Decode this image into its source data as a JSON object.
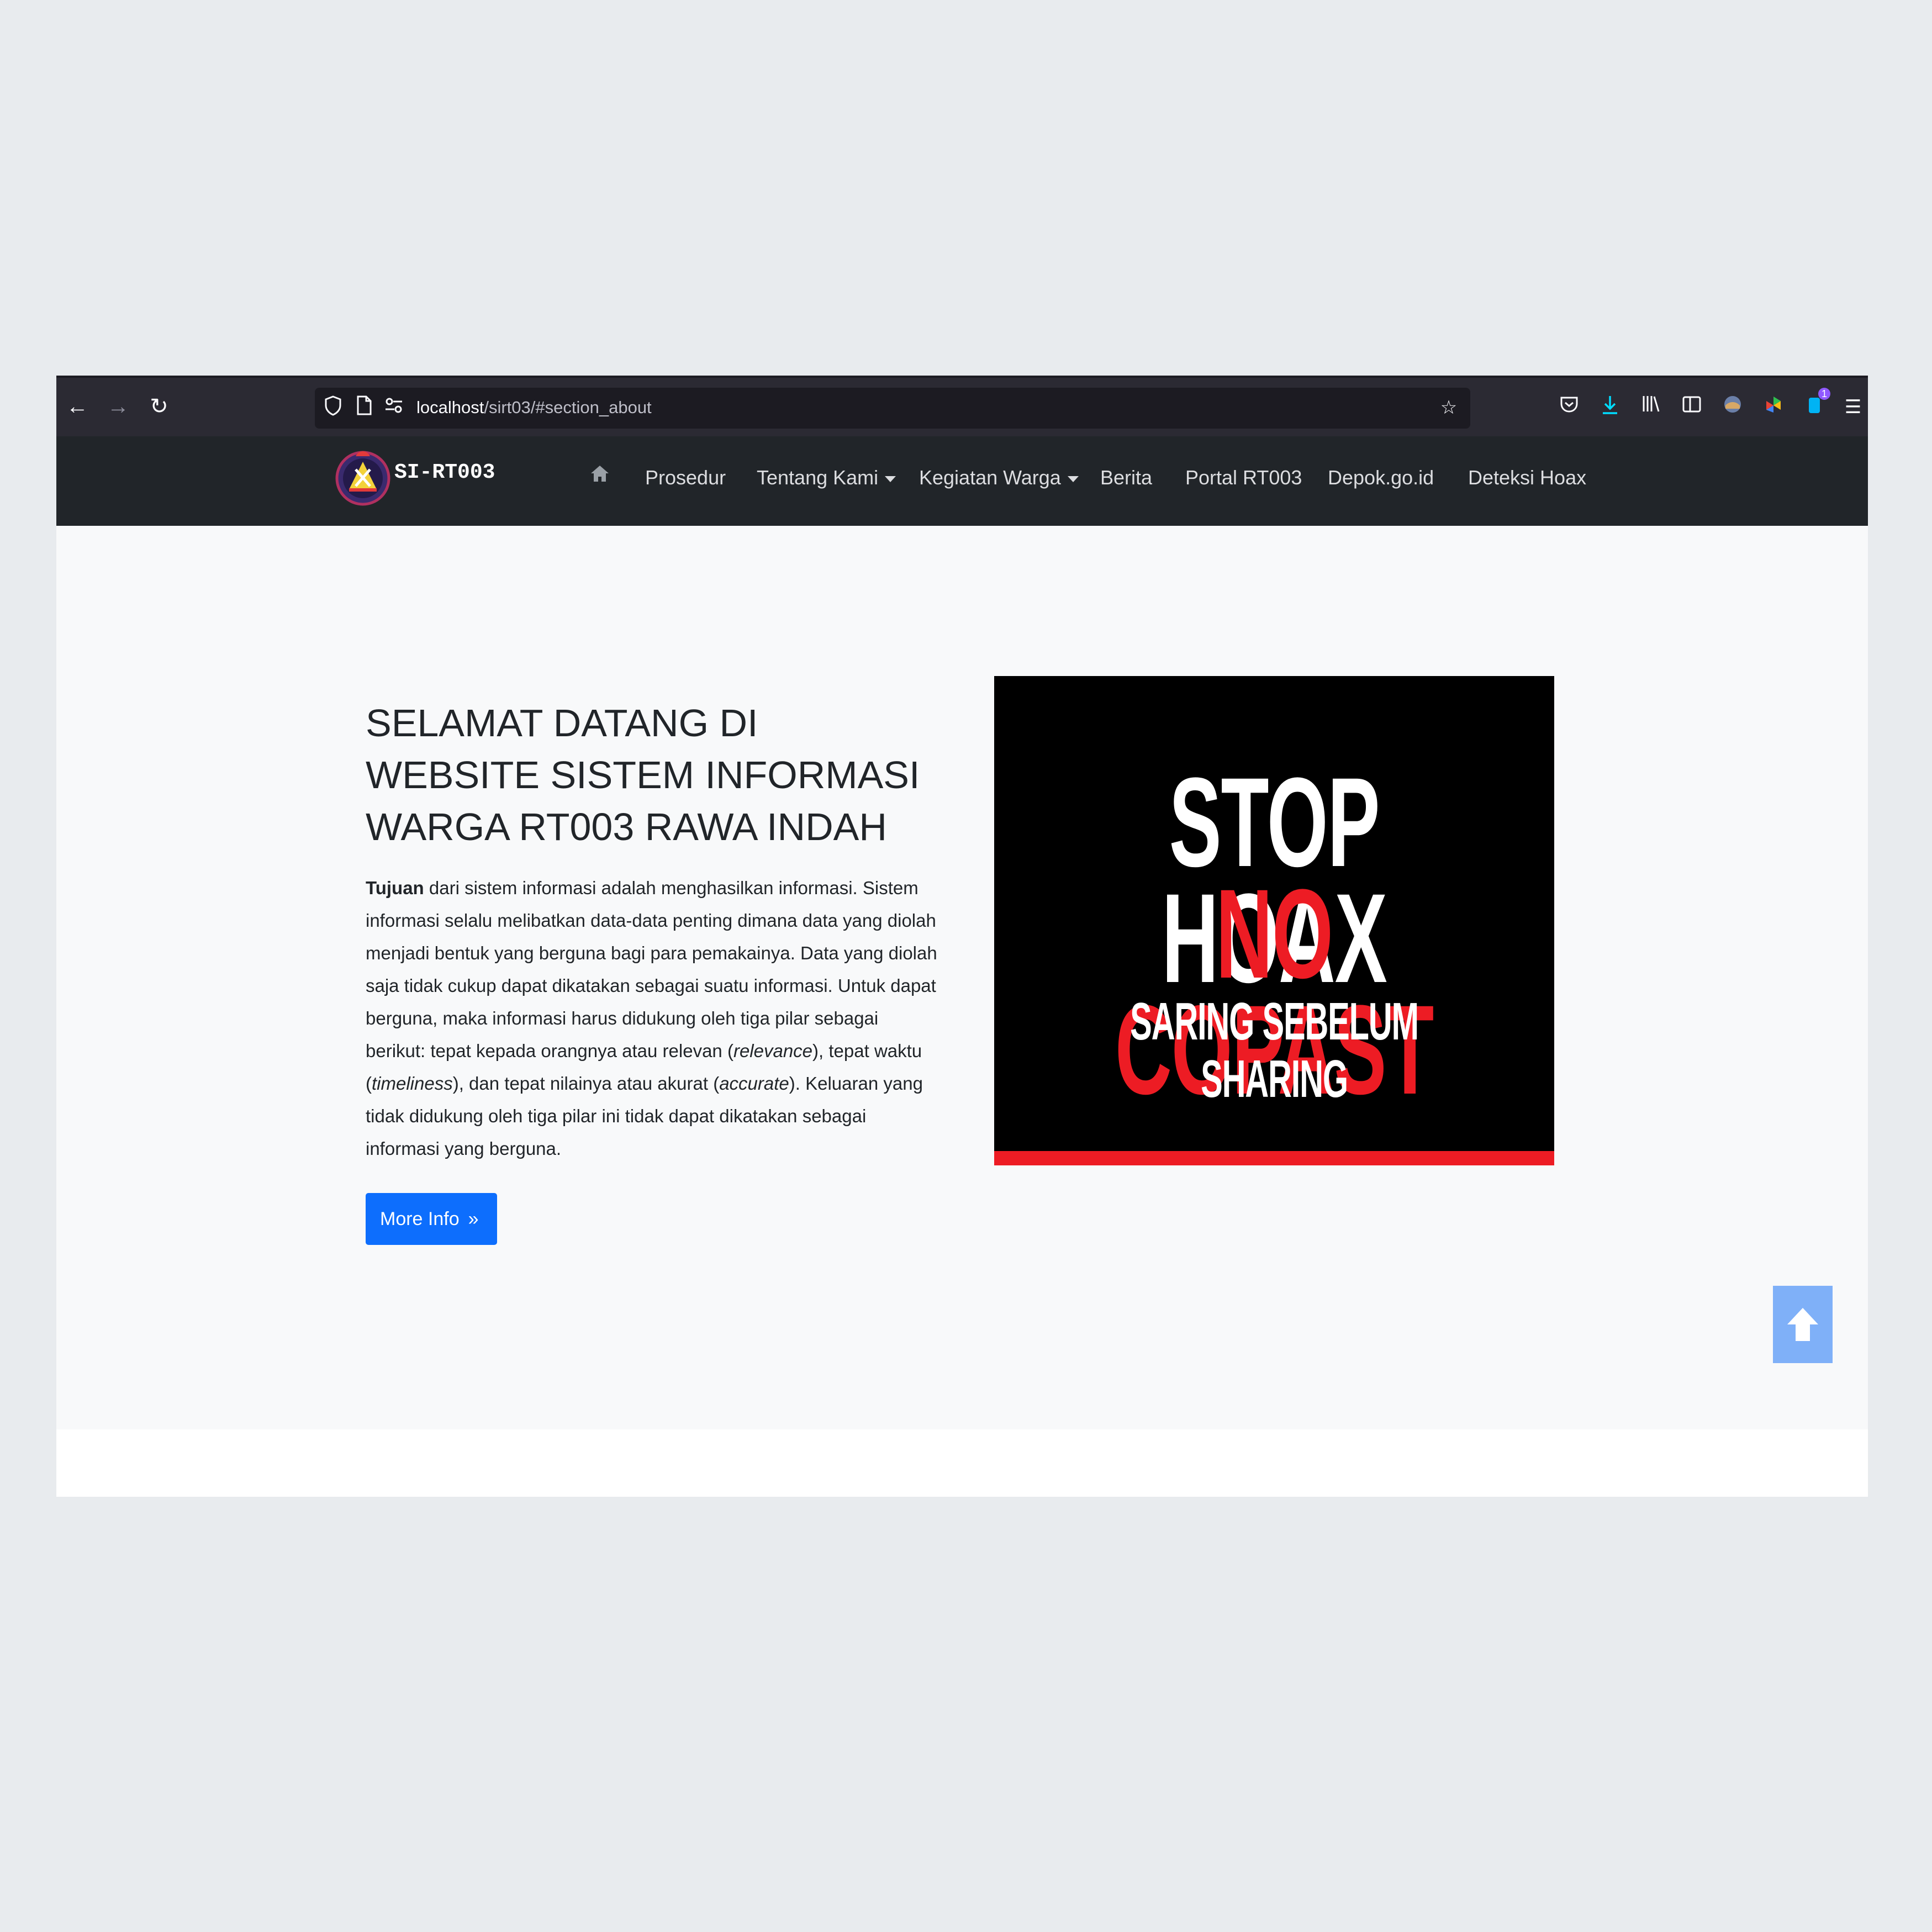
{
  "browser": {
    "url_host": "localhost",
    "url_path": "/sirt03/#section_about",
    "downloads_badge": "1"
  },
  "navbar": {
    "brand": "SI-RT003",
    "items": [
      {
        "label": "Prosedur"
      },
      {
        "label": "Tentang Kami"
      },
      {
        "label": "Kegiatan Warga"
      },
      {
        "label": "Berita"
      },
      {
        "label": "Portal RT003"
      },
      {
        "label": "Depok.go.id"
      },
      {
        "label": "Deteksi Hoax"
      }
    ]
  },
  "about": {
    "heading": "SELAMAT DATANG DI WEBSITE SISTEM INFORMASI WARGA RT003 RAWA INDAH",
    "para": {
      "bold": "Tujuan",
      "t1": " dari sistem informasi adalah menghasilkan informasi. Sistem informasi selalu melibatkan data-data penting dimana data yang diolah menjadi bentuk yang berguna bagi para pemakainya. Data yang diolah saja tidak cukup dapat dikatakan sebagai suatu informasi. Untuk dapat berguna, maka informasi harus didukung oleh tiga pilar sebagai berikut: tepat kepada orangnya atau relevan (",
      "i1": "relevance",
      "t2": "), tepat waktu (",
      "i2": "timeliness",
      "t3": "), dan tepat nilainya atau akurat (",
      "i3": "accurate",
      "t4": "). Keluaran yang tidak didukung oleh tiga pilar ini tidak dapat dikatakan sebagai informasi yang berguna."
    },
    "button_label": "More Info"
  },
  "poster": {
    "line1": "STOP HOAX",
    "line2": "NO COPAST",
    "line3": "SARING SEBELUM SHARING"
  },
  "colors": {
    "primary": "#0d6efd",
    "navbar_bg": "#212529",
    "poster_red": "#ed1c24",
    "scroll_top_bg": "#7fb0f8"
  }
}
